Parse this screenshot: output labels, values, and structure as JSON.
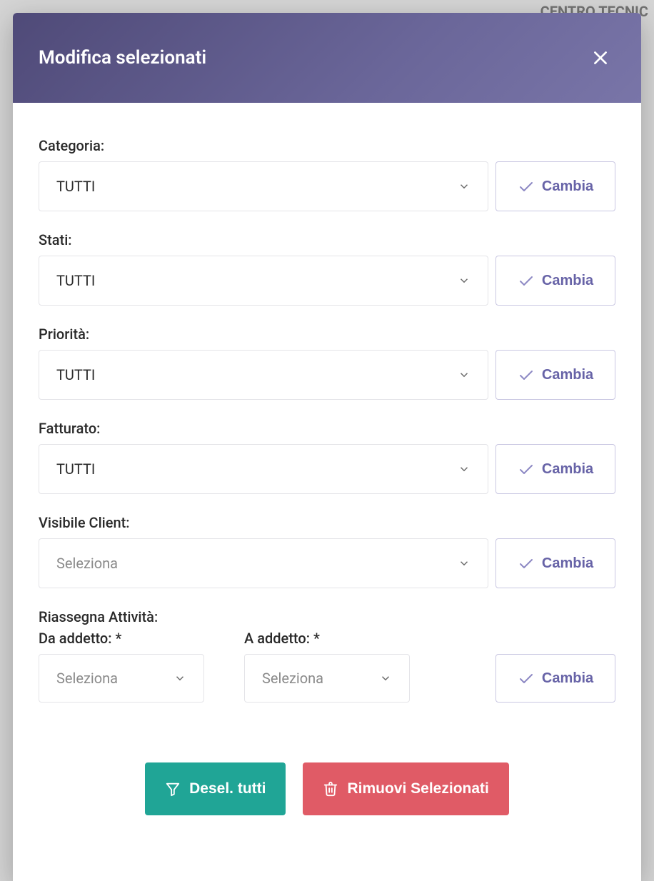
{
  "background": {
    "fragment": "CENTRO TECNIC"
  },
  "modal": {
    "title": "Modifica selezionati"
  },
  "fields": {
    "categoria": {
      "label": "Categoria:",
      "value": "TUTTI",
      "button": "Cambia"
    },
    "stati": {
      "label": "Stati:",
      "value": "TUTTI",
      "button": "Cambia"
    },
    "priorita": {
      "label": "Priorità:",
      "value": "TUTTI",
      "button": "Cambia"
    },
    "fatturato": {
      "label": "Fatturato:",
      "value": "TUTTI",
      "button": "Cambia"
    },
    "visibile": {
      "label": "Visibile Client:",
      "placeholder": "Seleziona",
      "button": "Cambia"
    }
  },
  "reassign": {
    "title": "Riassegna Attività:",
    "from_label": "Da addetto: *",
    "to_label": "A addetto: *",
    "from_placeholder": "Seleziona",
    "to_placeholder": "Seleziona",
    "button": "Cambia"
  },
  "footer": {
    "deselect": "Desel. tutti",
    "remove": "Rimuovi Selezionati"
  }
}
